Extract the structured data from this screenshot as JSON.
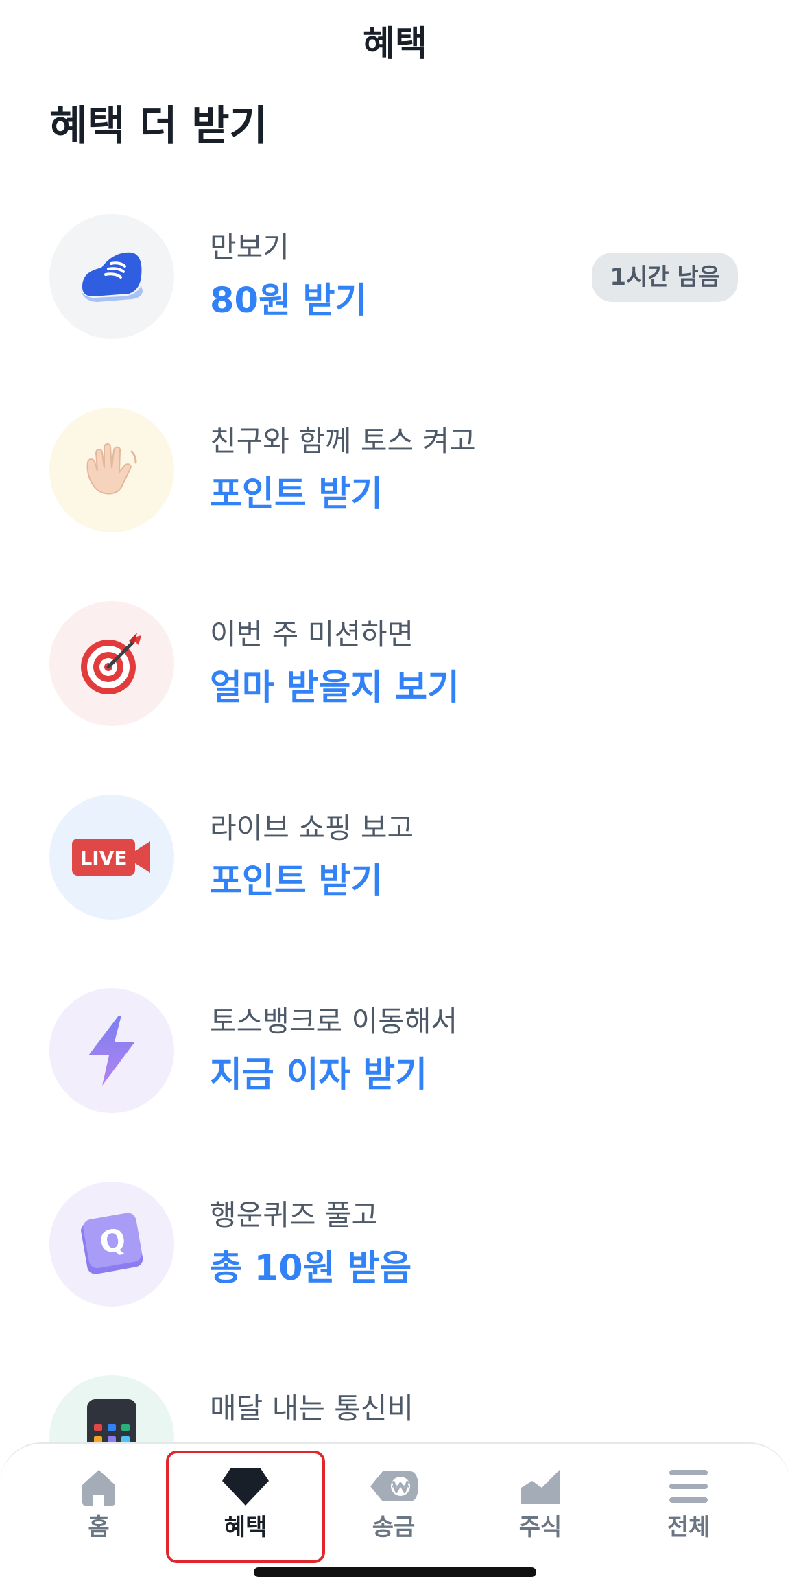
{
  "header": {
    "title": "혜택"
  },
  "section": {
    "title": "혜택 더 받기"
  },
  "benefits": [
    {
      "icon": "sneaker-icon",
      "description": "만보기",
      "action": "80원 받기",
      "badge": "1시간 남음",
      "icon_bg": "#f2f4f6"
    },
    {
      "icon": "waving-hand-icon",
      "description": "친구와 함께 토스 켜고",
      "action": "포인트 받기",
      "icon_bg": "#fdf8e6"
    },
    {
      "icon": "dart-target-icon",
      "description": "이번 주 미션하면",
      "action": "얼마 받을지 보기",
      "icon_bg": "#fcefef"
    },
    {
      "icon": "live-camera-icon",
      "description": "라이브 쇼핑 보고",
      "action": "포인트 받기",
      "icon_bg": "#eaf2fd"
    },
    {
      "icon": "lightning-icon",
      "description": "토스뱅크로 이동해서",
      "action": "지금 이자 받기",
      "icon_bg": "#f3eefc"
    },
    {
      "icon": "quiz-q-icon",
      "description": "행운퀴즈 풀고",
      "action": "총 10원 받음",
      "icon_bg": "#f3eefc"
    },
    {
      "icon": "phone-icon",
      "description": "매달 내는 통신비",
      "icon_bg": "#eaf6f2"
    }
  ],
  "badges": {
    "live_text": "LIVE",
    "quiz_letter": "Q"
  },
  "nav": {
    "items": [
      {
        "label": "홈",
        "icon": "home-icon"
      },
      {
        "label": "혜택",
        "icon": "gem-icon",
        "active": true
      },
      {
        "label": "송금",
        "icon": "won-transfer-icon"
      },
      {
        "label": "주식",
        "icon": "stock-chart-icon"
      },
      {
        "label": "전체",
        "icon": "menu-icon"
      }
    ]
  },
  "colors": {
    "accent": "#3182f6",
    "text_primary": "#191f28",
    "text_secondary": "#4e5968",
    "nav_inactive": "#a3acb7",
    "highlight_border": "#e0262b"
  }
}
